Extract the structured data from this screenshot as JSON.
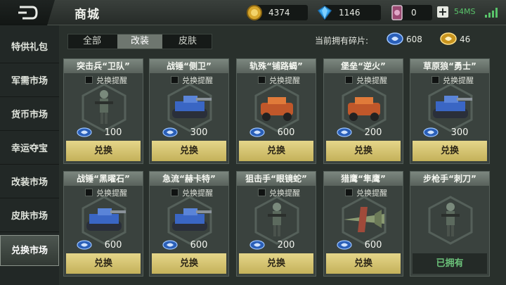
{
  "header": {
    "title": "商城",
    "currencies": {
      "gold": "4374",
      "diamond": "1146",
      "ticket": "0"
    },
    "ping": "54MS"
  },
  "sidebar": {
    "items": [
      {
        "label": "特供礼包",
        "active": false
      },
      {
        "label": "军需市场",
        "active": false
      },
      {
        "label": "货币市场",
        "active": false
      },
      {
        "label": "幸运夺宝",
        "active": false
      },
      {
        "label": "改装市场",
        "active": false
      },
      {
        "label": "皮肤市场",
        "active": false
      },
      {
        "label": "兑换市场",
        "active": true
      }
    ]
  },
  "tabs": [
    {
      "label": "全部",
      "active": false
    },
    {
      "label": "改装",
      "active": true
    },
    {
      "label": "皮肤",
      "active": false
    }
  ],
  "fragments": {
    "label": "当前拥有碎片:",
    "blue": "608",
    "gold": "46"
  },
  "cards": [
    {
      "name": "突击兵“卫队”",
      "remind": "兑换提醒",
      "price": "100",
      "action": "兑换",
      "owned": false,
      "icon": "soldier-icon"
    },
    {
      "name": "战锤“侧卫”",
      "remind": "兑换提醒",
      "price": "300",
      "action": "兑换",
      "owned": false,
      "icon": "tank-icon"
    },
    {
      "name": "轨殊“铺路蝎”",
      "remind": "兑换提醒",
      "price": "600",
      "action": "兑换",
      "owned": false,
      "icon": "vehicle-icon"
    },
    {
      "name": "堡垒“逆火”",
      "remind": "兑换提醒",
      "price": "200",
      "action": "兑换",
      "owned": false,
      "icon": "vehicle-icon"
    },
    {
      "name": "草原狼“勇士”",
      "remind": "兑换提醒",
      "price": "300",
      "action": "兑换",
      "owned": false,
      "icon": "tank-icon"
    },
    {
      "name": "战锤“黑曜石”",
      "remind": "兑换提醒",
      "price": "600",
      "action": "兑换",
      "owned": false,
      "icon": "tank-icon"
    },
    {
      "name": "急流“赫卡特”",
      "remind": "兑换提醒",
      "price": "600",
      "action": "兑换",
      "owned": false,
      "icon": "tank-icon"
    },
    {
      "name": "狙击手“眼镜蛇”",
      "remind": "兑换提醒",
      "price": "200",
      "action": "兑换",
      "owned": false,
      "icon": "soldier-icon"
    },
    {
      "name": "猎鹰“隼鹰”",
      "remind": "兑换提醒",
      "price": "600",
      "action": "兑换",
      "owned": false,
      "icon": "aircraft-icon"
    },
    {
      "name": "步枪手“刺刀”",
      "remind": "",
      "price": "",
      "action": "已拥有",
      "owned": true,
      "icon": "soldier-icon"
    }
  ]
}
